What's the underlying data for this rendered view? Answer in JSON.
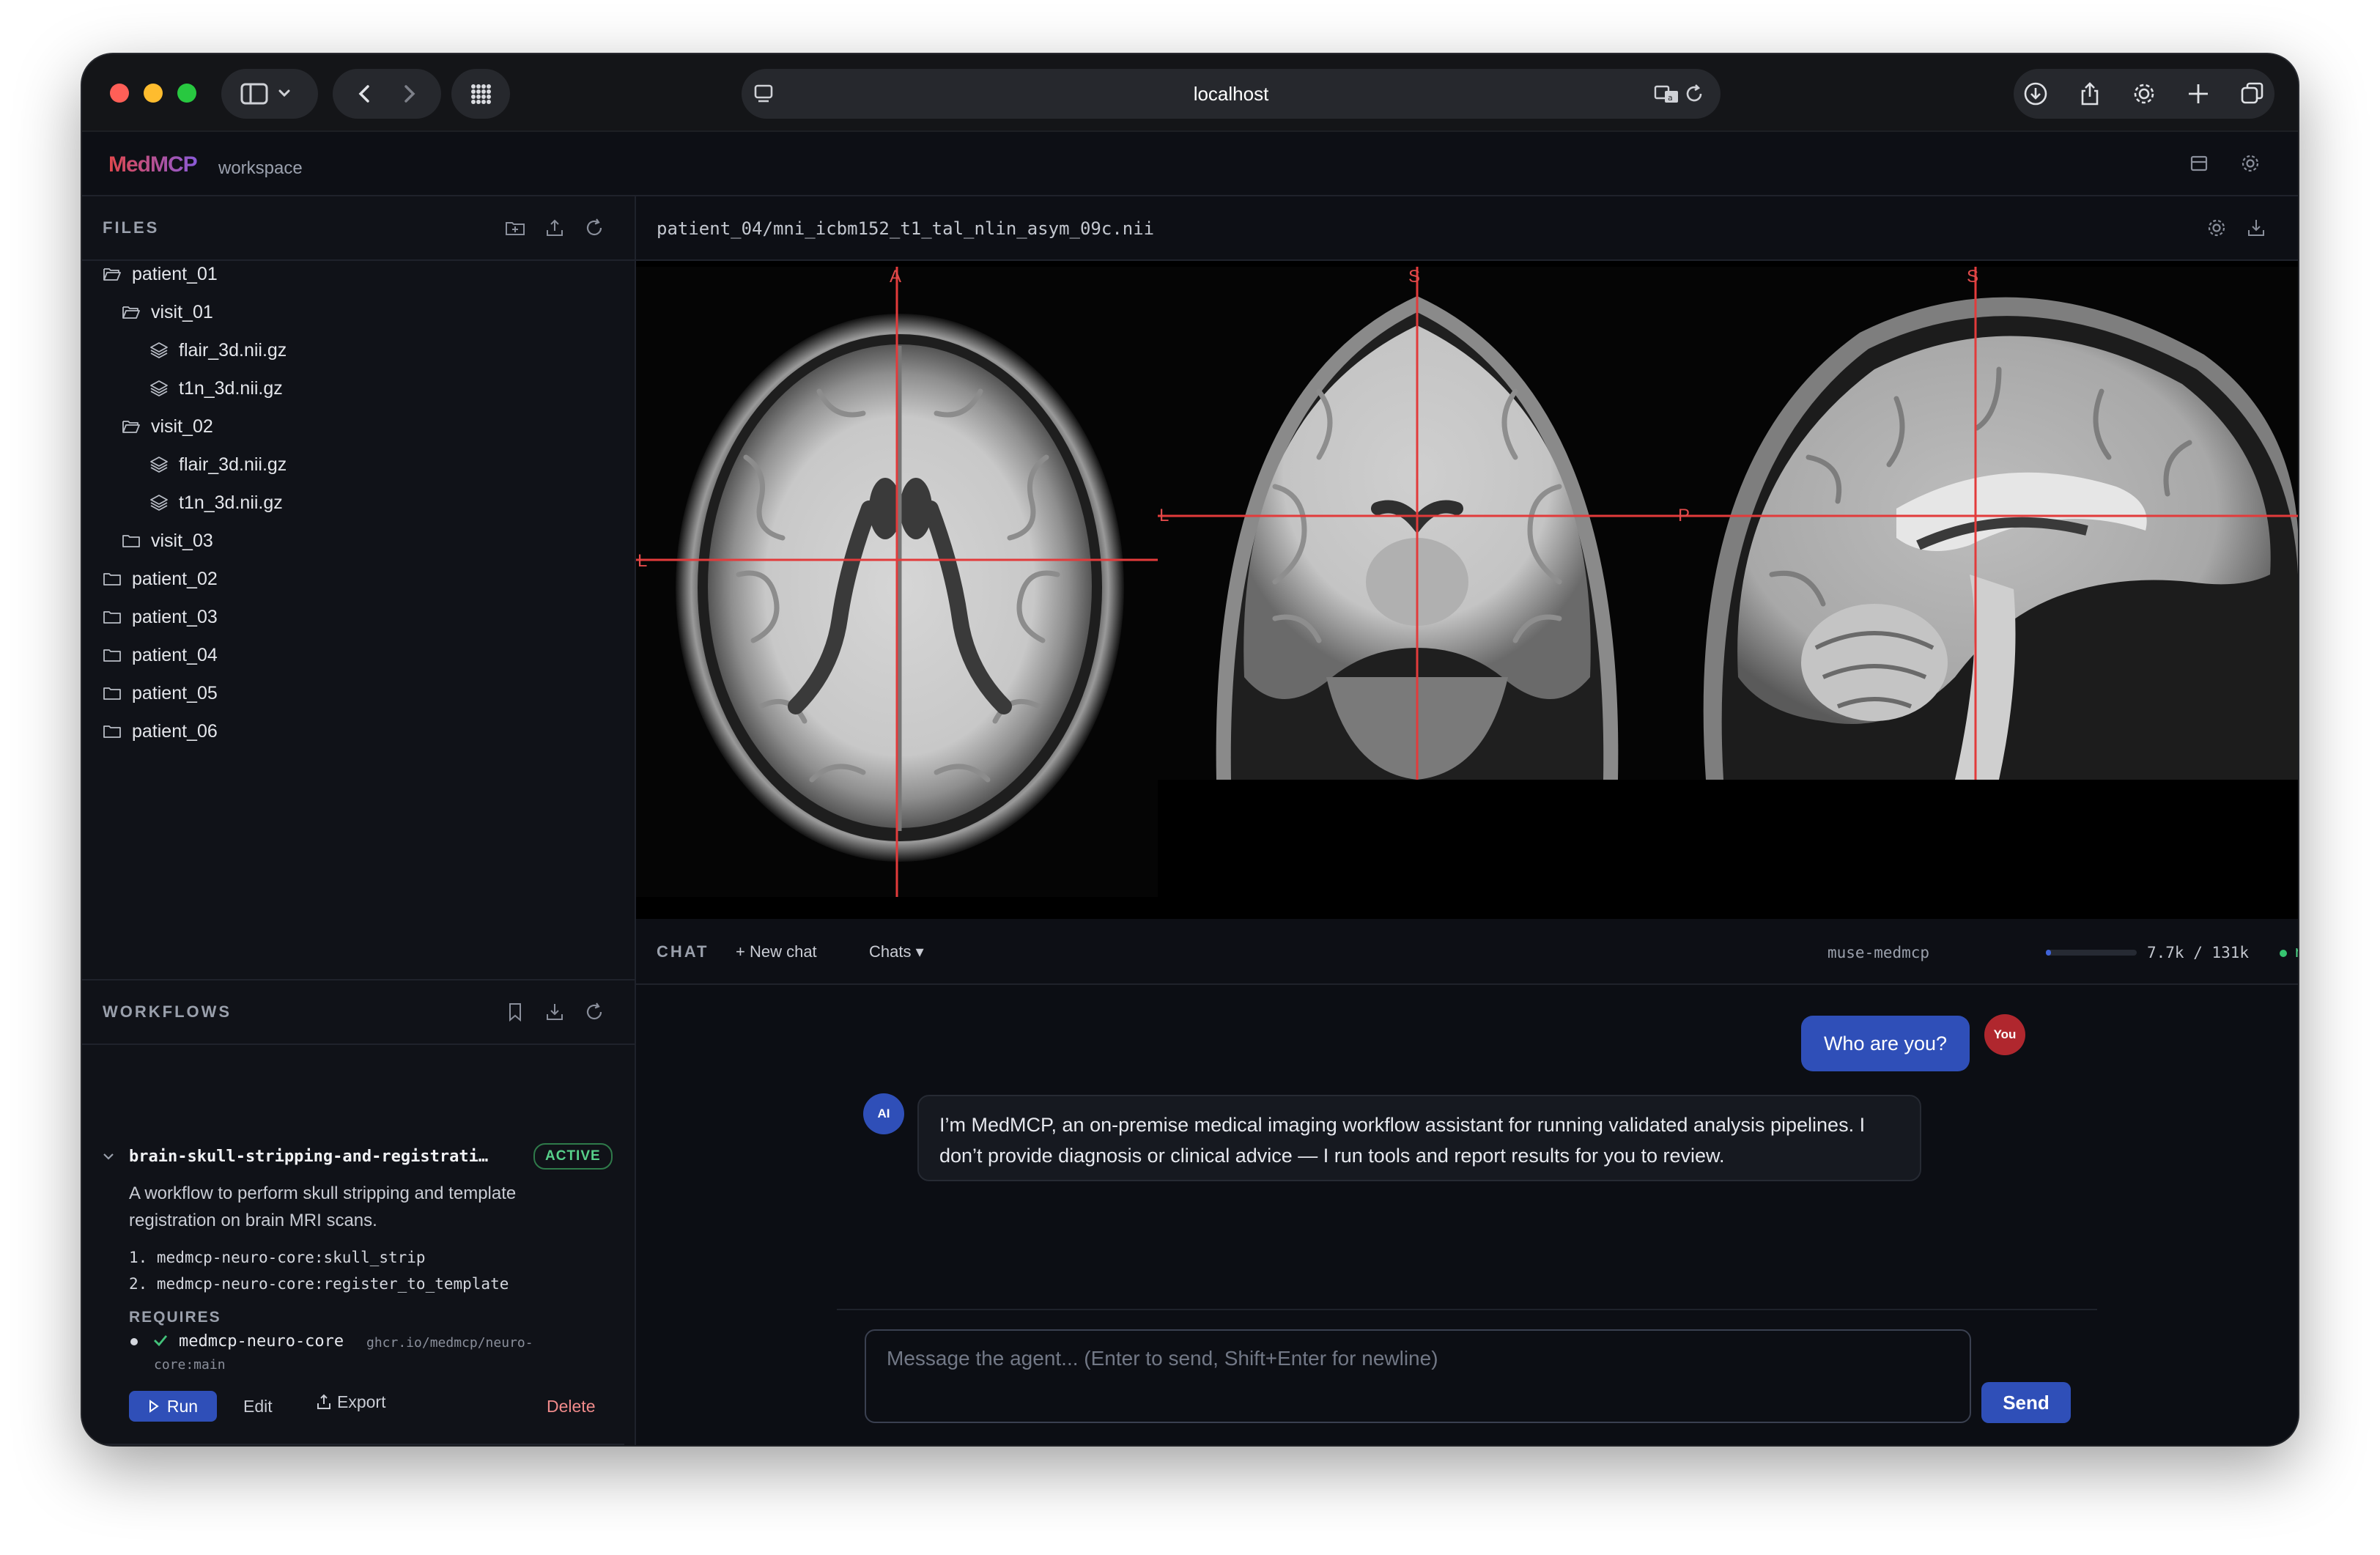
{
  "browser": {
    "url": "localhost",
    "traffic_lights": [
      "#ff5f57",
      "#febc2e",
      "#28c840"
    ]
  },
  "app": {
    "brand": "MedMCP",
    "subtitle": "workspace"
  },
  "files": {
    "title": "FILES",
    "tree": [
      {
        "label": "patient_01",
        "type": "folder-open",
        "depth": 0
      },
      {
        "label": "visit_01",
        "type": "folder-open",
        "depth": 1
      },
      {
        "label": "flair_3d.nii.gz",
        "type": "file",
        "depth": 2
      },
      {
        "label": "t1n_3d.nii.gz",
        "type": "file",
        "depth": 2
      },
      {
        "label": "visit_02",
        "type": "folder-open",
        "depth": 1
      },
      {
        "label": "flair_3d.nii.gz",
        "type": "file",
        "depth": 2
      },
      {
        "label": "t1n_3d.nii.gz",
        "type": "file",
        "depth": 2
      },
      {
        "label": "visit_03",
        "type": "folder",
        "depth": 1
      },
      {
        "label": "patient_02",
        "type": "folder",
        "depth": 0
      },
      {
        "label": "patient_03",
        "type": "folder",
        "depth": 0
      },
      {
        "label": "patient_04",
        "type": "folder",
        "depth": 0
      },
      {
        "label": "patient_05",
        "type": "folder",
        "depth": 0
      },
      {
        "label": "patient_06",
        "type": "folder",
        "depth": 0
      }
    ]
  },
  "workflows": {
    "title": "WORKFLOWS",
    "item": {
      "name": "brain-skull-stripping-and-registrati…",
      "status": "ACTIVE",
      "description": "A workflow to perform skull stripping and template registration on brain MRI scans.",
      "steps": [
        "1. medmcp-neuro-core:skull_strip",
        "2. medmcp-neuro-core:register_to_template"
      ],
      "requires_label": "REQUIRES",
      "requirement_name": "medmcp-neuro-core",
      "requirement_image_1": "ghcr.io/medmcp/neuro-",
      "requirement_image_2": "core:main",
      "run_label": "Run",
      "edit_label": "Edit",
      "export_label": "Export",
      "delete_label": "Delete"
    }
  },
  "viewer": {
    "path": "patient_04/mni_icbm152_t1_tal_nlin_asym_09c.nii",
    "orientation_labels": {
      "axial_top": "A",
      "axial_left": "L",
      "coronal_top": "S",
      "coronal_left": "L",
      "sagittal_top": "S",
      "sagittal_left": "P"
    },
    "crosshair_color": "#e23b3b"
  },
  "chat": {
    "title": "CHAT",
    "new_chat": "+ New chat",
    "chats_menu": "Chats ▾",
    "model": "muse-medmcp",
    "tokens": "7.7k / 131k",
    "token_fraction": 0.059,
    "status": "running",
    "messages": [
      {
        "role": "user",
        "avatar": "You",
        "text": "Who are you?"
      },
      {
        "role": "assistant",
        "avatar": "AI",
        "text": "I’m MedMCP, an on-premise medical imaging workflow assistant for running validated analysis pipelines. I don’t provide diagnosis or clinical advice — I run tools and report results for you to review."
      }
    ],
    "input_placeholder": "Message the agent... (Enter to send, Shift+Enter for newline)",
    "send_label": "Send"
  }
}
